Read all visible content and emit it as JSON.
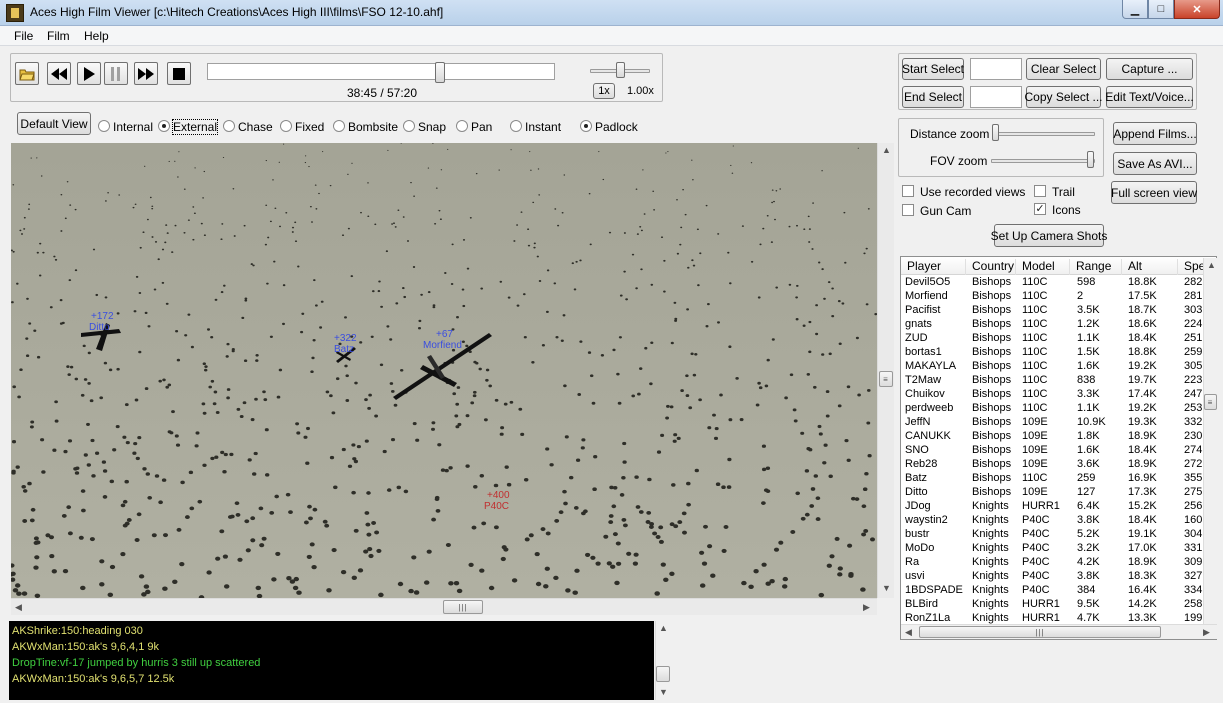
{
  "window": {
    "title": "Aces High Film Viewer [c:\\Hitech Creations\\Aces High III\\films\\FSO 12-10.ahf]"
  },
  "menu": [
    "File",
    "Film",
    "Help"
  ],
  "playback": {
    "time": "38:45 / 57:20",
    "position": 0.676,
    "speed_label": "1x",
    "speed_value": "1.00x"
  },
  "selection": {
    "start_select": "Start Select",
    "end_select": "End Select",
    "clear_select": "Clear Select",
    "copy_select": "Copy Select ...",
    "capture": "Capture ...",
    "edit_text_voice": "Edit Text/Voice..."
  },
  "view": {
    "default_view": "Default View",
    "modes": [
      {
        "label": "Internal",
        "checked": false
      },
      {
        "label": "External",
        "checked": true
      },
      {
        "label": "Chase",
        "checked": false
      },
      {
        "label": "Fixed",
        "checked": false
      },
      {
        "label": "Bombsite",
        "checked": false
      },
      {
        "label": "Snap",
        "checked": false
      },
      {
        "label": "Pan",
        "checked": false
      },
      {
        "label": "Instant",
        "checked": false
      },
      {
        "label": "Padlock",
        "checked": true
      }
    ]
  },
  "zoom": {
    "distance_label": "Distance zoom",
    "fov_label": "FOV zoom",
    "distance_level": 0.0,
    "fov_level": 1.0
  },
  "side_buttons": {
    "append_films": "Append Films...",
    "save_avi": "Save As AVI...",
    "full_screen": "Full screen view",
    "camera_shots": "Set Up Camera Shots"
  },
  "options": [
    {
      "label": "Use recorded views",
      "checked": false
    },
    {
      "label": "Trail",
      "checked": false
    },
    {
      "label": "Gun Cam",
      "checked": false
    },
    {
      "label": "Icons",
      "checked": true
    }
  ],
  "aircraft_labels": [
    {
      "range": "+172",
      "name": "Ditto",
      "color": "#3a4ee0"
    },
    {
      "range": "+322",
      "name": "Batz",
      "color": "#3a4ee0"
    },
    {
      "range": "+67",
      "name": "Morfiend",
      "color": "#3a4ee0"
    },
    {
      "range": "+400",
      "name": "P40C",
      "color": "#c03030"
    }
  ],
  "console": [
    {
      "text": "AKShrike:150:heading 030",
      "color": "#e0e070"
    },
    {
      "text": "AKWxMan:150:ak's 9,6,4,1  9k",
      "color": "#e0e070"
    },
    {
      "text": "DropTine:vf-17 jumped by hurris  3 still up  scattered",
      "color": "#40d040"
    },
    {
      "text": "AKWxMan:150:ak's 9,6,5,7 12.5k",
      "color": "#e0e070"
    }
  ],
  "player_list": {
    "columns": [
      "Player",
      "Country",
      "Model",
      "Range",
      "Alt",
      "Spe"
    ],
    "rows": [
      [
        "Devil5O5",
        "Bishops",
        "110C",
        "598",
        "18.8K",
        "282"
      ],
      [
        "Morfiend",
        "Bishops",
        "110C",
        "2",
        "17.5K",
        "281"
      ],
      [
        "Pacifist",
        "Bishops",
        "110C",
        "3.5K",
        "18.7K",
        "303"
      ],
      [
        "gnats",
        "Bishops",
        "110C",
        "1.2K",
        "18.6K",
        "224"
      ],
      [
        "ZUD",
        "Bishops",
        "110C",
        "1.1K",
        "18.4K",
        "251"
      ],
      [
        "bortas1",
        "Bishops",
        "110C",
        "1.5K",
        "18.8K",
        "259"
      ],
      [
        "MAKAYLA",
        "Bishops",
        "110C",
        "1.6K",
        "19.2K",
        "305"
      ],
      [
        "T2Maw",
        "Bishops",
        "110C",
        "838",
        "19.7K",
        "223"
      ],
      [
        "Chuikov",
        "Bishops",
        "110C",
        "3.3K",
        "17.4K",
        "247"
      ],
      [
        "perdweeb",
        "Bishops",
        "110C",
        "1.1K",
        "19.2K",
        "253"
      ],
      [
        "JeffN",
        "Bishops",
        "109E",
        "10.9K",
        "19.3K",
        "332"
      ],
      [
        "CANUKK",
        "Bishops",
        "109E",
        "1.8K",
        "18.9K",
        "230"
      ],
      [
        "SNO",
        "Bishops",
        "109E",
        "1.6K",
        "18.4K",
        "274"
      ],
      [
        "Reb28",
        "Bishops",
        "109E",
        "3.6K",
        "18.9K",
        "272"
      ],
      [
        "Batz",
        "Bishops",
        "110C",
        "259",
        "16.9K",
        "355"
      ],
      [
        "Ditto",
        "Bishops",
        "109E",
        "127",
        "17.3K",
        "275"
      ],
      [
        "JDog",
        "Knights",
        "HURR1",
        "6.4K",
        "15.2K",
        "256"
      ],
      [
        "waystin2",
        "Knights",
        "P40C",
        "3.8K",
        "18.4K",
        "160"
      ],
      [
        "bustr",
        "Knights",
        "P40C",
        "5.2K",
        "19.1K",
        "304"
      ],
      [
        "MoDo",
        "Knights",
        "P40C",
        "3.2K",
        "17.0K",
        "331"
      ],
      [
        "Ra",
        "Knights",
        "P40C",
        "4.2K",
        "18.9K",
        "309"
      ],
      [
        "usvi",
        "Knights",
        "P40C",
        "3.8K",
        "18.3K",
        "327"
      ],
      [
        "1BDSPADE",
        "Knights",
        "P40C",
        "384",
        "16.4K",
        "334"
      ],
      [
        "BLBird",
        "Knights",
        "HURR1",
        "9.5K",
        "14.2K",
        "258"
      ],
      [
        "RonZ1La",
        "Knights",
        "HURR1",
        "4.7K",
        "13.3K",
        "199"
      ]
    ]
  },
  "colors": {
    "terrain": "#a8a898",
    "console_bg": "#000000"
  }
}
